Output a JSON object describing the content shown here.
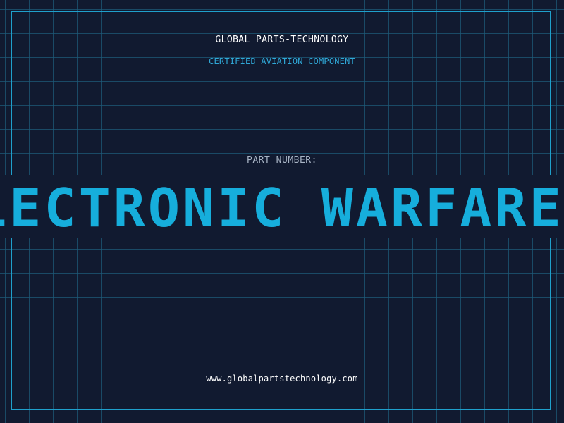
{
  "header": {
    "company_name": "GLOBAL PARTS-TECHNOLOGY",
    "subtitle": "CERTIFIED AVIATION COMPONENT"
  },
  "part": {
    "label": "PART NUMBER:",
    "value": "ELECTRONIC WARFARE SYSTEM"
  },
  "footer": {
    "website": "www.globalpartstechnology.com"
  },
  "colors": {
    "background": "#111a30",
    "grid": "#1e5a78",
    "accent": "#16aedc",
    "frame": "#1fa0cc",
    "text_primary": "#ffffff",
    "text_secondary": "#a7b3c4"
  }
}
